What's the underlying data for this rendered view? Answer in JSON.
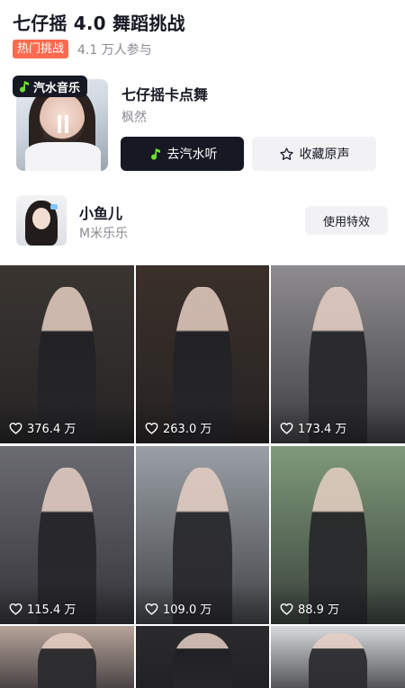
{
  "header": {
    "title": "七仔摇 4.0 舞蹈挑战",
    "hot_tag": "热门挑战",
    "participants": "4.1 万人参与"
  },
  "music": {
    "source_badge": "汽水音乐",
    "song_title": "七仔摇卡点舞",
    "artist": "枫然",
    "listen_button": "去汽水听",
    "favorite_button": "收藏原声"
  },
  "effect": {
    "creator_name": "小鱼儿",
    "creator_sub": "M米乐乐",
    "use_button": "使用特效"
  },
  "videos": [
    {
      "likes": "376.4 万",
      "tone": "#3a3530"
    },
    {
      "likes": "263.0 万",
      "tone": "#3b3029"
    },
    {
      "likes": "173.4 万",
      "tone": "#8e8c8e"
    },
    {
      "likes": "115.4 万",
      "tone": "#6b6b72"
    },
    {
      "likes": "109.0 万",
      "tone": "#9aa0a6"
    },
    {
      "likes": "88.9 万",
      "tone": "#7f9a7a"
    },
    {
      "likes": "",
      "tone": "#b7a49a"
    },
    {
      "likes": "",
      "tone": "#2b2a2d"
    },
    {
      "likes": "",
      "tone": "#d8dadd"
    }
  ],
  "colors": {
    "hot_tag": "#fe6b4f",
    "primary_button": "#161823",
    "secondary_button": "#f2f2f4",
    "muted_text": "#8a8b91"
  },
  "icons": [
    "music-note-icon",
    "pause-icon",
    "star-icon",
    "heart-icon"
  ]
}
